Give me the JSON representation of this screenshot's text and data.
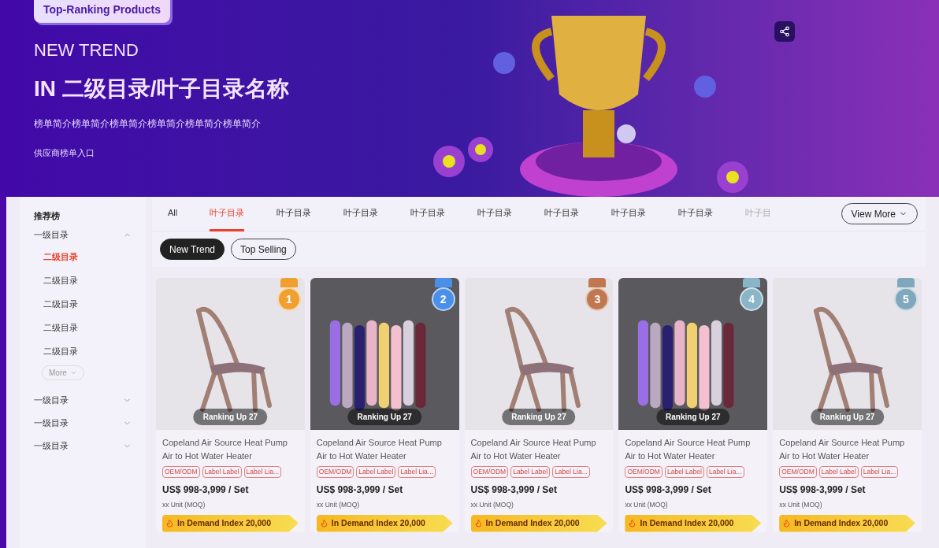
{
  "banner": {
    "badge": "Top-Ranking Products",
    "heading": "NEW TREND",
    "title": "IN 二级目录/叶子目录名称",
    "description": "榜单简介榜单简介榜单简介榜单简介榜单简介榜单简介",
    "link": "供应商榜单入口"
  },
  "sidebar": {
    "title": "推荐榜",
    "groups": [
      {
        "label": "一级目录",
        "expanded": true,
        "children": [
          {
            "label": "二级目录",
            "selected": true
          },
          {
            "label": "二级目录",
            "selected": false
          },
          {
            "label": "二级目录",
            "selected": false
          },
          {
            "label": "二级目录",
            "selected": false
          },
          {
            "label": "二级目录",
            "selected": false
          }
        ],
        "more": "More"
      },
      {
        "label": "一级目录",
        "expanded": false
      },
      {
        "label": "一级目录",
        "expanded": false
      },
      {
        "label": "一级目录",
        "expanded": false
      }
    ]
  },
  "tabs": [
    {
      "label": "All",
      "selected": false
    },
    {
      "label": "叶子目录",
      "selected": true
    },
    {
      "label": "叶子目录",
      "selected": false
    },
    {
      "label": "叶子目录",
      "selected": false
    },
    {
      "label": "叶子目录",
      "selected": false
    },
    {
      "label": "叶子目录",
      "selected": false
    },
    {
      "label": "叶子目录",
      "selected": false
    },
    {
      "label": "叶子目录",
      "selected": false
    },
    {
      "label": "叶子目录",
      "selected": false
    },
    {
      "label": "叶子目",
      "selected": false
    }
  ],
  "view_more": "View More",
  "chips": [
    {
      "label": "New Trend",
      "selected": true
    },
    {
      "label": "Top Selling",
      "selected": false
    }
  ],
  "products": [
    {
      "kind": "chair",
      "rank": "1",
      "color": "#f0a030",
      "ranking": "Ranking Up 27",
      "title": "Copeland Air Source Heat Pump Air to Hot Water Heater",
      "tags": [
        "OEM/ODM",
        "Label Label",
        "Label Lia..."
      ],
      "price": "US$ 998-3,999 / Set",
      "moq": "xx Unit (MOQ)",
      "demand": "In Demand Index 20,000"
    },
    {
      "kind": "tubes",
      "rank": "2",
      "color": "#4a90e8",
      "ranking": "Ranking Up 27",
      "title": "Copeland Air Source Heat Pump Air to Hot Water Heater",
      "tags": [
        "OEM/ODM",
        "Label Label",
        "Label Lia..."
      ],
      "price": "US$ 998-3,999 / Set",
      "moq": "xx Unit (MOQ)",
      "demand": "In Demand Index 20,000"
    },
    {
      "kind": "chair",
      "rank": "3",
      "color": "#c07850",
      "ranking": "Ranking Up 27",
      "title": "Copeland Air Source Heat Pump Air to Hot Water Heater",
      "tags": [
        "OEM/ODM",
        "Label Label",
        "Label Lia..."
      ],
      "price": "US$ 998-3,999 / Set",
      "moq": "xx Unit (MOQ)",
      "demand": "In Demand Index 20,000"
    },
    {
      "kind": "tubes",
      "rank": "4",
      "color": "#8ab4c8",
      "ranking": "Ranking Up 27",
      "title": "Copeland Air Source Heat Pump Air to Hot Water Heater",
      "tags": [
        "OEM/ODM",
        "Label Label",
        "Label Lia..."
      ],
      "price": "US$ 998-3,999 / Set",
      "moq": "xx Unit (MOQ)",
      "demand": "In Demand Index 20,000"
    },
    {
      "kind": "chair",
      "rank": "5",
      "color": "#7fa8bc",
      "ranking": "Ranking Up 27",
      "title": "Copeland Air Source Heat Pump Air to Hot Water Heater",
      "tags": [
        "OEM/ODM",
        "Label Label",
        "Label Lia..."
      ],
      "price": "US$ 998-3,999 / Set",
      "moq": "xx Unit (MOQ)",
      "demand": "In Demand Index 20,000"
    }
  ]
}
